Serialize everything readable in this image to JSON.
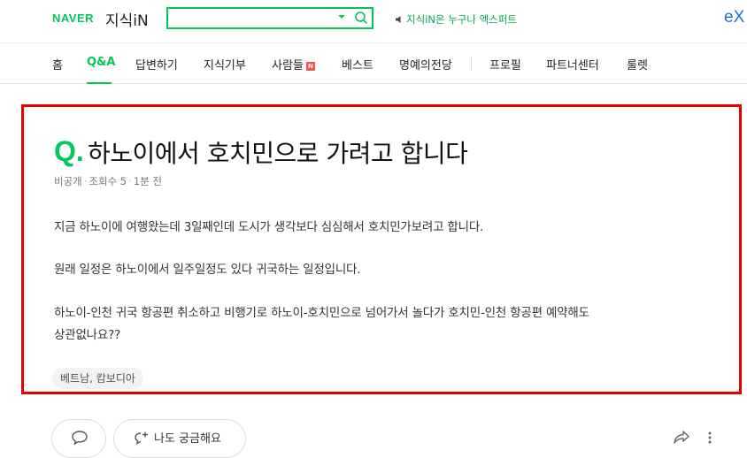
{
  "header": {
    "logo_naver": "NAVER",
    "logo_kin": "지식iN",
    "search_placeholder": "",
    "notice": "지식iN은 누구나 엑스퍼트",
    "expert_partial": "eX"
  },
  "nav": {
    "items": [
      {
        "label": "홈"
      },
      {
        "label": "Q&A"
      },
      {
        "label": "답변하기"
      },
      {
        "label": "지식기부"
      },
      {
        "label": "사람들"
      },
      {
        "label": "베스트"
      },
      {
        "label": "명예의전당"
      },
      {
        "label": "프로필"
      },
      {
        "label": "파트너센터"
      },
      {
        "label": "룰렛"
      }
    ],
    "new_badge": "N",
    "active": "Q&A"
  },
  "question": {
    "mark": "Q.",
    "title": "하노이에서 호치민으로 가려고 합니다",
    "meta": {
      "author": "비공개",
      "views": "조회수 5",
      "time": "1분 전"
    },
    "body": [
      "지금 하노이에 여행왔는데 3일째인데 도시가 생각보다 심심해서 호치민가보려고 합니다.",
      "원래 일정은 하노이에서 일주일정도 있다 귀국하는 일정입니다.",
      "하노이-인천 귀국 항공편 취소하고 비행기로 하노이-호치민으로 넘어가서 놀다가 호치민-인천 항공편 예약해도",
      "상관없나요??"
    ],
    "tag": "베트남, 캄보디아"
  },
  "actions": {
    "curious_label": "나도 궁금해요"
  },
  "colors": {
    "brand_green": "#03c75a",
    "highlight_red": "#e00000",
    "badge_red": "#f0584f"
  }
}
